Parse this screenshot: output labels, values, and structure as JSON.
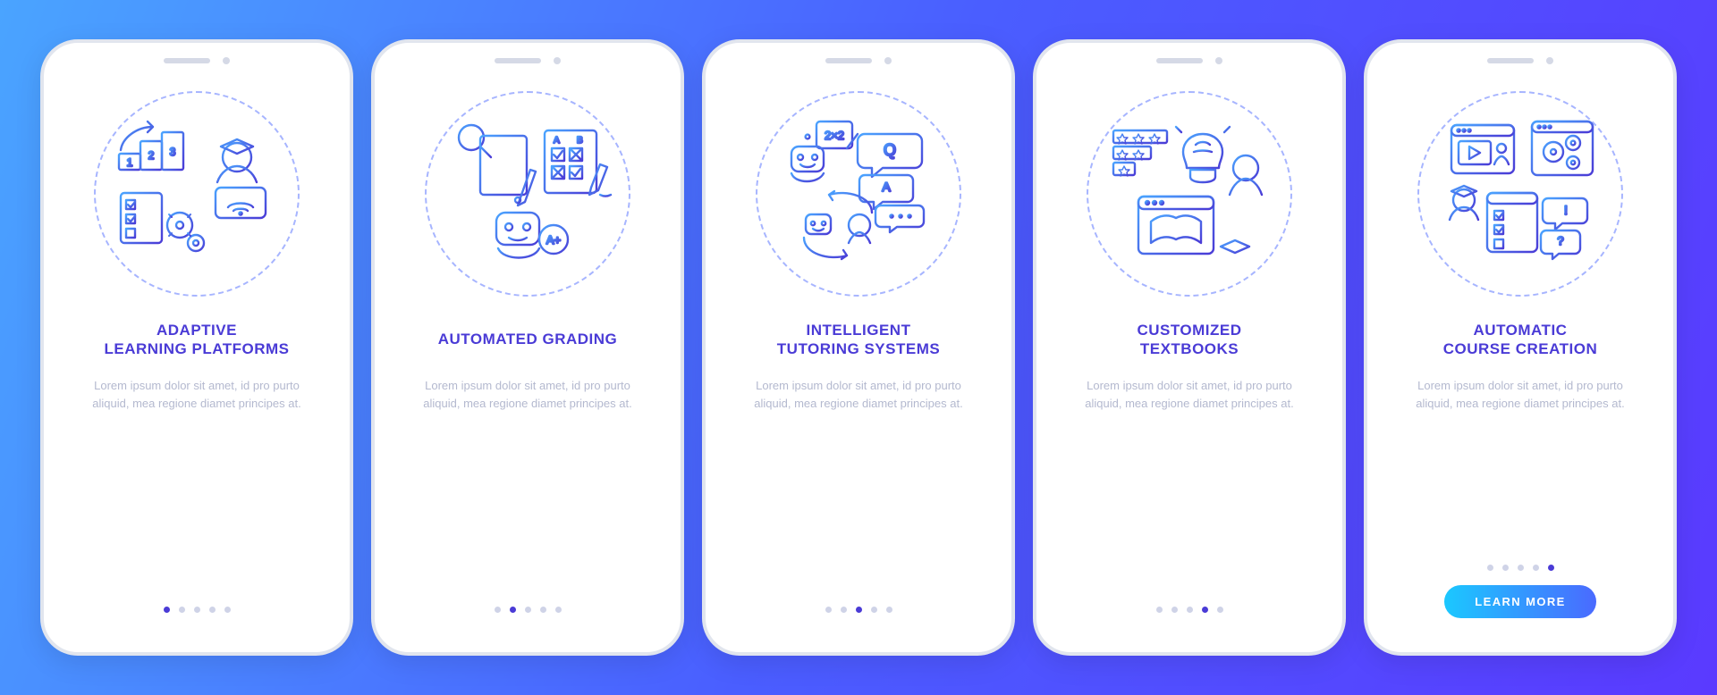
{
  "lorem": "Lorem ipsum dolor sit amet, id pro purto aliquid, mea regione diamet principes at.",
  "cta_label": "LEARN MORE",
  "slides": [
    {
      "id": "adaptive-learning",
      "title": "ADAPTIVE\nLEARNING PLATFORMS",
      "active_dot": 0,
      "has_cta": false
    },
    {
      "id": "automated-grading",
      "title": "AUTOMATED GRADING",
      "active_dot": 1,
      "has_cta": false
    },
    {
      "id": "tutoring-systems",
      "title": "INTELLIGENT\nTUTORING SYSTEMS",
      "active_dot": 2,
      "has_cta": false
    },
    {
      "id": "customized-textbooks",
      "title": "CUSTOMIZED\nTEXTBOOKS",
      "active_dot": 3,
      "has_cta": false
    },
    {
      "id": "course-creation",
      "title": "AUTOMATIC\nCOURSE CREATION",
      "active_dot": 4,
      "has_cta": true
    }
  ],
  "icons": {
    "adaptive-learning": "adaptive-learning-icon",
    "automated-grading": "automated-grading-icon",
    "tutoring-systems": "tutoring-systems-icon",
    "customized-textbooks": "customized-textbooks-icon",
    "course-creation": "course-creation-icon"
  }
}
